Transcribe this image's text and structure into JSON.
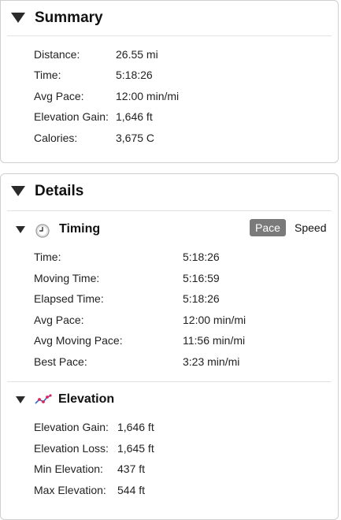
{
  "summary": {
    "title": "Summary",
    "rows": [
      {
        "label": "Distance:",
        "value": "26.55 mi"
      },
      {
        "label": "Time:",
        "value": "5:18:26"
      },
      {
        "label": "Avg Pace:",
        "value": "12:00 min/mi"
      },
      {
        "label": "Elevation Gain:",
        "value": "1,646 ft"
      },
      {
        "label": "Calories:",
        "value": "3,675 C"
      }
    ]
  },
  "details": {
    "title": "Details",
    "timing": {
      "title": "Timing",
      "icon": "clock-icon",
      "toggle": {
        "active": "Pace",
        "inactive": "Speed"
      },
      "rows": [
        {
          "label": "Time:",
          "value": "5:18:26"
        },
        {
          "label": "Moving Time:",
          "value": "5:16:59"
        },
        {
          "label": "Elapsed Time:",
          "value": "5:18:26"
        },
        {
          "label": "Avg Pace:",
          "value": "12:00 min/mi"
        },
        {
          "label": "Avg Moving Pace:",
          "value": "11:56 min/mi"
        },
        {
          "label": "Best Pace:",
          "value": "3:23 min/mi"
        }
      ]
    },
    "elevation": {
      "title": "Elevation",
      "icon": "elevation-chart-icon",
      "rows": [
        {
          "label": "Elevation Gain:",
          "value": "1,646 ft"
        },
        {
          "label": "Elevation Loss:",
          "value": "1,645 ft"
        },
        {
          "label": "Min Elevation:",
          "value": "437 ft"
        },
        {
          "label": "Max Elevation:",
          "value": "544 ft"
        }
      ]
    }
  },
  "colors": {
    "toggle_active_bg": "#7a7a7a",
    "elevation_icon_line": "#3366cc",
    "elevation_icon_points": "#e0245e",
    "clock_face": "#9a9a9a"
  }
}
